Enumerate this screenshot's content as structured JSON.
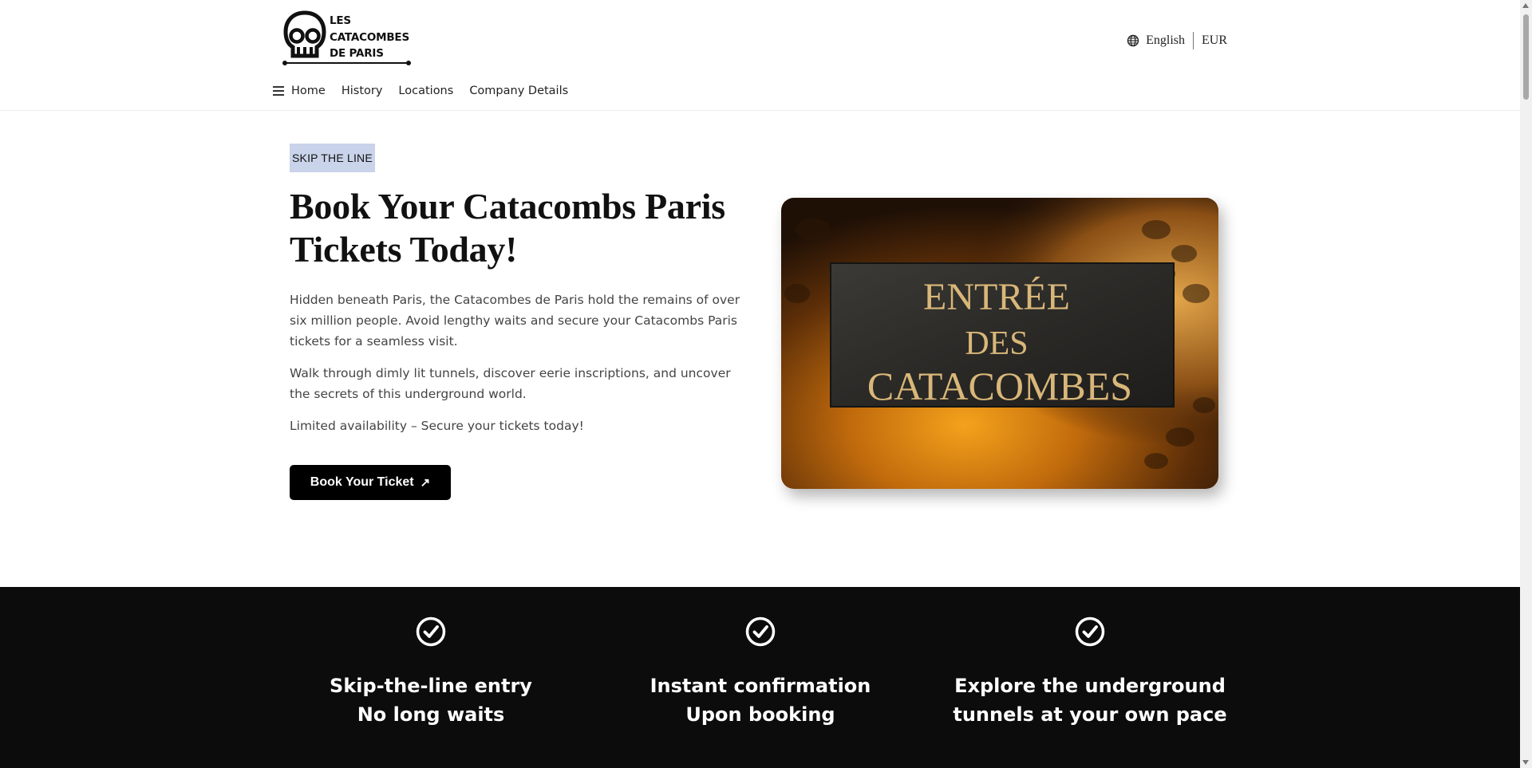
{
  "header": {
    "logo_lines": [
      "LES",
      "CATACOMBES",
      "DE PARIS"
    ],
    "language": "English",
    "currency": "EUR"
  },
  "nav": {
    "items": [
      "Home",
      "History",
      "Locations",
      "Company Details"
    ]
  },
  "hero": {
    "badge": "SKIP THE LINE",
    "title": "Book Your Catacombs Paris Tickets Today!",
    "paragraphs": [
      "Hidden beneath Paris, the Catacombes de Paris hold the remains of over six million people. Avoid lengthy waits and secure your Catacombs Paris tickets for a seamless visit.",
      "Walk through dimly lit tunnels, discover eerie inscriptions, and uncover the secrets of this underground world.",
      "Limited availability – Secure your tickets today!"
    ],
    "cta_label": "Book Your Ticket",
    "cta_icon": "↗",
    "image_sign": [
      "ENTRÉE",
      "DES",
      "CATACOMBES"
    ]
  },
  "features": [
    {
      "icon": "check-circle-icon",
      "lines": [
        "Skip-the-line entry",
        "No long waits"
      ]
    },
    {
      "icon": "check-circle-icon",
      "lines": [
        "Instant confirmation",
        "Upon booking"
      ]
    },
    {
      "icon": "check-circle-icon",
      "lines": [
        "Explore the underground",
        "tunnels at your own pace"
      ]
    }
  ],
  "colors": {
    "badge_bg": "#c9d3ea",
    "cta_bg": "#000000",
    "band_bg": "#0c0c0c",
    "sign_text": "#d9b779"
  }
}
